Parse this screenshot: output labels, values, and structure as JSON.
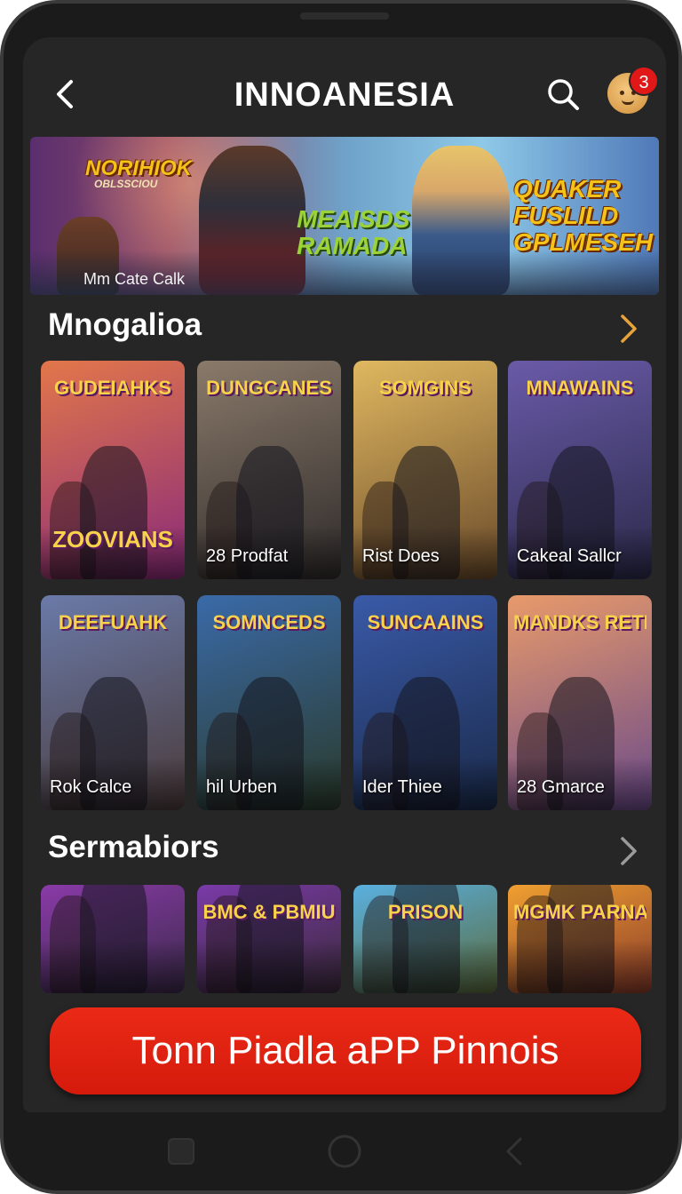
{
  "header": {
    "title": "INNOANESIA",
    "notification_count": "3"
  },
  "banner": {
    "words": [
      "NORIHIOK",
      "OBLSSCIOU",
      "MEAISDS RAMADA",
      "QUAKER FUSLILD GPLMESEH"
    ],
    "caption": "Mm Cate Calk"
  },
  "section1": {
    "title": "Mnogalioa",
    "cards": [
      {
        "logo": "GUDEIAHKS",
        "label": "",
        "colors": [
          "#e2774a",
          "#8a2a7a"
        ]
      },
      {
        "logo": "DUNGCANES",
        "label": "28 Prodfat",
        "colors": [
          "#8a7a6a",
          "#2e2a2a"
        ]
      },
      {
        "logo": "SOMGINS",
        "label": "Rist Does",
        "colors": [
          "#e0b860",
          "#6a4a2a"
        ]
      },
      {
        "logo": "MNAWAINS",
        "label": "Cakeal Sallcr",
        "colors": [
          "#6a5aa8",
          "#2a2a4a"
        ]
      },
      {
        "logo": "DEEFUAHK",
        "label": "Rok Calce",
        "colors": [
          "#6a7aa8",
          "#4a3a3a"
        ]
      },
      {
        "logo": "SOMNCEDS",
        "label": "hil Urben",
        "colors": [
          "#3a6aa8",
          "#2a3a2a"
        ]
      },
      {
        "logo": "SUNCAAINS",
        "label": "Ider Thiee",
        "colors": [
          "#3a5aa8",
          "#1a2a4a"
        ]
      },
      {
        "logo": "MANDKS RETIKIA",
        "label": "28 Gmarce",
        "colors": [
          "#e89a6a",
          "#6a4a8a"
        ]
      }
    ],
    "bottom_logo_card1": "ZOOVIANS"
  },
  "section2": {
    "title": "Sermabiors",
    "cards": [
      {
        "logo": "",
        "colors": [
          "#8a3aa8",
          "#3a2a4a"
        ]
      },
      {
        "logo": "BMC & PBMIU",
        "colors": [
          "#7a3aa8",
          "#3a2a3a"
        ]
      },
      {
        "logo": "PRISON",
        "colors": [
          "#5ab0e0",
          "#5a6a3a"
        ]
      },
      {
        "logo": "MGMK PARNAS",
        "colors": [
          "#f0a030",
          "#8a3a2a"
        ]
      }
    ]
  },
  "cta": {
    "label": "Tonn Piadla aPP Pinnois"
  },
  "icons": {
    "back": "chevron-left-icon",
    "search": "search-icon",
    "more": "chevron-right-icon",
    "nav_recent": "square-icon",
    "nav_home": "circle-icon",
    "nav_back": "chevron-left-icon"
  },
  "colors": {
    "background": "#262626",
    "accent": "#e2221a",
    "chevron_orange": "#e8a23a"
  }
}
